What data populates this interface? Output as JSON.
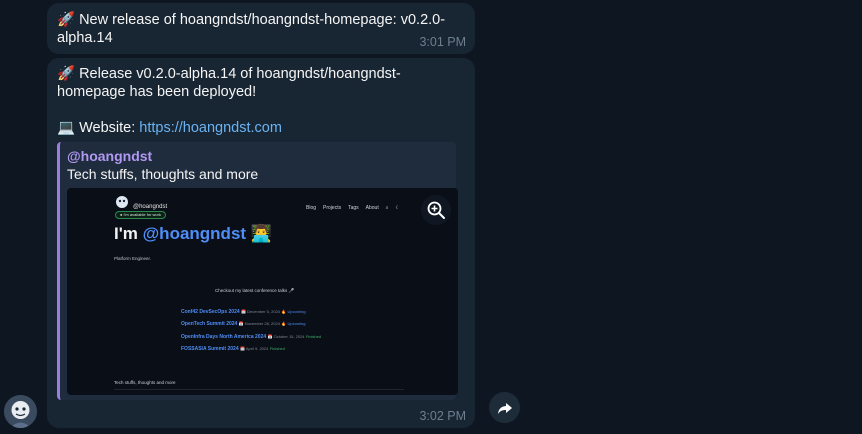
{
  "messages": [
    {
      "text": "🚀 New release of hoangndst/hoangndst-homepage: v0.2.0-alpha.14",
      "time": "3:01 PM"
    },
    {
      "text": "🚀 Release v0.2.0-alpha.14 of hoangndst/hoangndst-homepage has been deployed!",
      "website_prefix": "💻 Website: ",
      "website_url": "https://hoangndst.com",
      "time": "3:02 PM",
      "preview": {
        "site_name": "@hoangndst",
        "description": "Tech stuffs, thoughts and more",
        "screenshot": {
          "logo_name": "@hoangndst",
          "badge": "I'm available for work",
          "nav": [
            "Blog",
            "Projects",
            "Tags",
            "About"
          ],
          "hero_prefix": "I'm ",
          "hero_handle": "@hoangndst",
          "hero_emoji": "👨‍💻",
          "subtitle": "Platform Engineer.",
          "checkout": "Checkout my latest conference talks 🎤",
          "talks": [
            {
              "title": "Conf42 DevSecOps 2024",
              "date": "📅 December 5, 2024",
              "status_icon": "🔥",
              "status": "Upcoming",
              "finished": false
            },
            {
              "title": "OpenTech Summit 2024",
              "date": "📅 November 28, 2024",
              "status_icon": "🔥",
              "status": "Upcoming",
              "finished": false
            },
            {
              "title": "OpenInfra Days North America 2024",
              "date": "📅 October 15, 2024",
              "status_icon": "",
              "status": "Finished",
              "finished": true
            },
            {
              "title": "FOSSASIA Summit 2024",
              "date": "📅 April 9, 2024",
              "status_icon": "",
              "status": "Finished",
              "finished": true
            }
          ],
          "footer": "Tech stuffs, thoughts and more"
        }
      }
    }
  ],
  "icons": {
    "zoom": "zoom-in-icon",
    "share": "share-arrow-icon",
    "avatar": "user-avatar"
  },
  "colors": {
    "background": "#0e1621",
    "bubble": "#182533",
    "link": "#6ab3f3",
    "preview_accent": "#9b7de0",
    "site_name": "#b198f2",
    "time": "#6d7f8f"
  }
}
